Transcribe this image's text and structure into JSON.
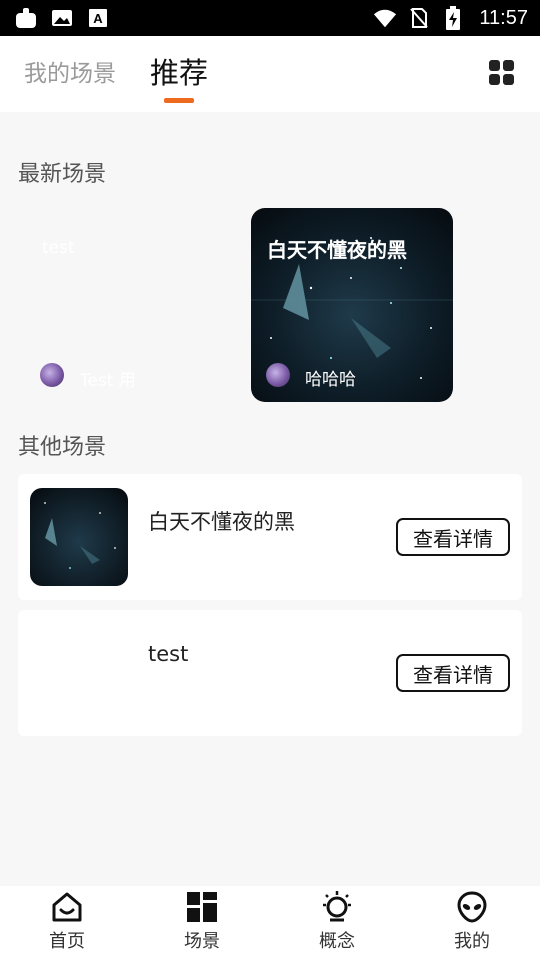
{
  "status_bar": {
    "time": "11:57",
    "left_icons": [
      "notification-app-icon",
      "image-icon",
      "text-a-icon"
    ],
    "right_icons": [
      "wifi-icon",
      "no-sim-icon",
      "battery-charging-icon"
    ]
  },
  "tabs": [
    {
      "label": "我的场景",
      "active": false
    },
    {
      "label": "推荐",
      "active": true
    }
  ],
  "accent_color": "#ee6a1f",
  "latest": {
    "title": "最新场景",
    "cards": [
      {
        "title": "test",
        "author": "Test 用"
      },
      {
        "title": "白天不懂夜的黑",
        "author": "哈哈哈"
      }
    ]
  },
  "others": {
    "title": "其他场景",
    "items": [
      {
        "title": "白天不懂夜的黑",
        "button": "查看详情"
      },
      {
        "title": "test",
        "button": "查看详情"
      }
    ]
  },
  "bottom_nav": [
    {
      "label": "首页",
      "icon": "home-icon"
    },
    {
      "label": "场景",
      "icon": "scene-grid-icon"
    },
    {
      "label": "概念",
      "icon": "lightbulb-icon"
    },
    {
      "label": "我的",
      "icon": "alien-icon"
    }
  ]
}
